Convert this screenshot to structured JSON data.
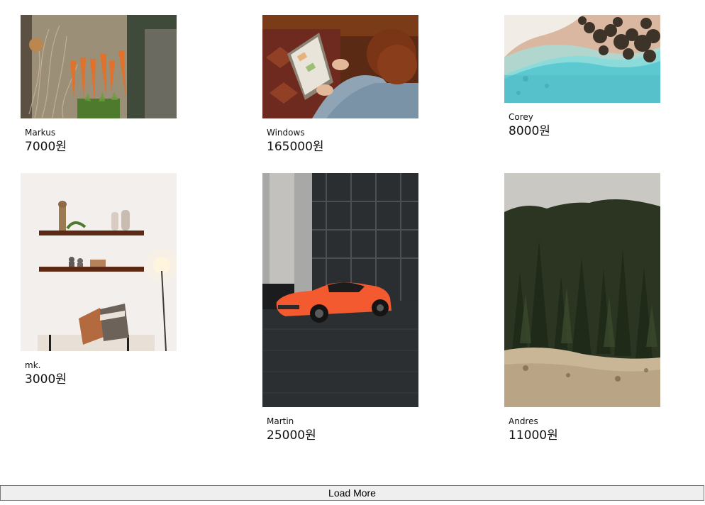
{
  "items": [
    {
      "author": "Markus",
      "price": "7000원",
      "image": "carrots-and-onions-photo"
    },
    {
      "author": "Windows",
      "price": "165000원",
      "image": "woman-using-laptop-photo"
    },
    {
      "author": "Corey",
      "price": "8000원",
      "image": "aerial-beach-photo"
    },
    {
      "author": "mk.",
      "price": "3000원",
      "image": "wall-shelves-interior-photo"
    },
    {
      "author": "Martin",
      "price": "25000원",
      "image": "orange-sports-car-photo"
    },
    {
      "author": "Andres",
      "price": "11000원",
      "image": "pine-forest-photo"
    }
  ],
  "load_more": {
    "label": "Load More"
  }
}
